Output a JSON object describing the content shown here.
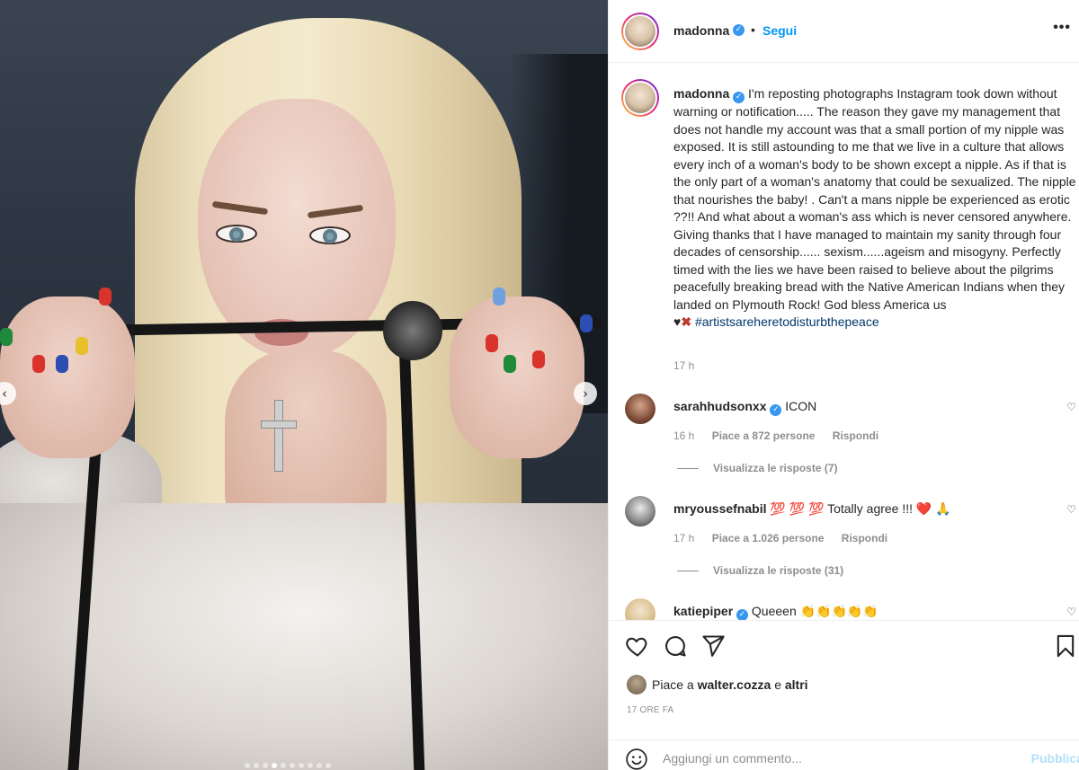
{
  "post": {
    "author": "madonna",
    "follow_sep": "•",
    "follow_label": "Segui",
    "more_glyph": "•••"
  },
  "caption": {
    "author": "madonna",
    "text": "I'm reposting photographs Instagram took down without warning or notification..... The reason they gave my management that does not handle my account was that a small portion of my nipple was exposed. It is still astounding to me that we live in a culture that allows every inch of a woman's body to be shown except a nipple. As if that is the only part of a woman's anatomy that could be sexualized. The nipple that nourishes the baby! . Can't a mans nipple be experienced as erotic ??!! And what about a woman's ass which is never censored anywhere. Giving thanks that I have managed to maintain my sanity through four decades of censorship...... sexism......ageism and misogyny. Perfectly timed with the lies we have been raised to believe about the pilgrims peacefully breaking bread with the Native American Indians when they landed on Plymouth Rock! God bless America us",
    "emoji_heart": "♥",
    "emoji_x": "✖",
    "hashtag": "#artistsareheretodisturbthepeace",
    "time": "17 h"
  },
  "comments": [
    {
      "username": "sarahhudsonxx",
      "text": "ICON",
      "time": "16 h",
      "likes": "Piace a 872 persone",
      "reply": "Rispondi",
      "view_replies": "Visualizza le risposte (7)"
    },
    {
      "username": "mryoussefnabil",
      "emoji_prefix": "💯 💯 💯",
      "text": "Totally agree !!!",
      "emoji_suffix": "❤️ 🙏",
      "time": "17 h",
      "likes": "Piace a 1.026 persone",
      "reply": "Rispondi",
      "view_replies": "Visualizza le risposte (31)"
    },
    {
      "username": "katiepiper",
      "text": "Queeen",
      "emoji_suffix": "👏👏👏👏👏"
    }
  ],
  "likes": {
    "prefix": "Piace a",
    "user": "walter.cozza",
    "middle": "e",
    "suffix": "altri"
  },
  "time_ago": "17 ORE FA",
  "add_comment": {
    "placeholder": "Aggiungi un commento...",
    "publish_label": "Pubblica"
  },
  "carousel": {
    "prev_glyph": "‹",
    "next_glyph": "›",
    "slide_count": 10,
    "active_index": 3
  },
  "colors": {
    "accent": "#0095f6",
    "verified": "#3897f0",
    "publish_disabled": "#b2dffc",
    "muted_text": "#8e8e8e"
  }
}
